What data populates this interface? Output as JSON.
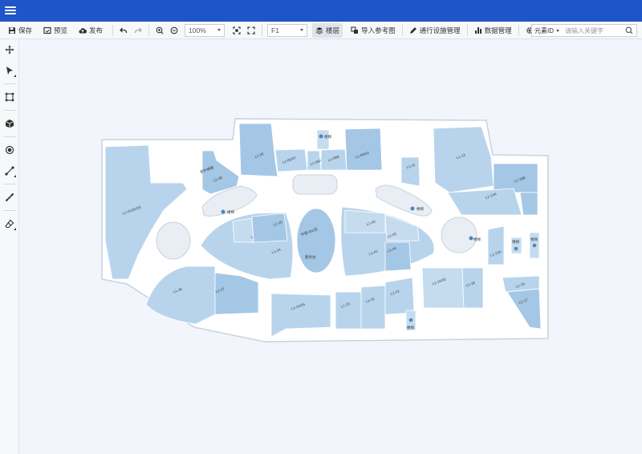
{
  "toolbar": {
    "save": "保存",
    "preview": "预览",
    "publish": "发布",
    "zoom": "100%",
    "floor": "F1",
    "layers": "楼层",
    "import_ref": "导入参考图",
    "facility_mgmt": "通行设施管理",
    "data_mgmt": "数据管理"
  },
  "search": {
    "type": "元素ID",
    "placeholder": "请输入关键字"
  },
  "sidebar": {
    "tools": [
      "move-icon",
      "select-icon",
      "polygon-icon",
      "cube-icon",
      "point-icon",
      "line-icon",
      "measure-icon",
      "eraser-icon"
    ]
  },
  "map": {
    "shops": [
      "L1-01/02/03",
      "L1-05",
      "L1-06/07",
      "L1-08A",
      "L1-08B",
      "L1-09/10",
      "L1-11",
      "L1-13",
      "L1-18B",
      "L1-14A",
      "L1-08",
      "L1-15",
      "L1-32",
      "L1-34",
      "L1-40",
      "L1-41",
      "L1-43",
      "L1-44",
      "L1-15A",
      "L1-19/20",
      "L1-18",
      "L1-16",
      "L1-17",
      "L1-26",
      "L1-27",
      "L1-24/25",
      "L1-23",
      "L1-22",
      "L1-21"
    ],
    "named_areas": [
      "室外楼梯",
      "中庭 B/C区",
      "服务台"
    ],
    "stair_labels": [
      "楼梯",
      "楼梯",
      "楼梯",
      "楼梯",
      "楼梯",
      "楼梯",
      "楼梯"
    ]
  },
  "colors": {
    "topbar": "#1e56c8",
    "shop_fill": "#b8d4ed",
    "shop_fill_dark": "#a4c7e6",
    "canvas_bg": "#f2f6fc",
    "marker": "#4a86c8"
  }
}
